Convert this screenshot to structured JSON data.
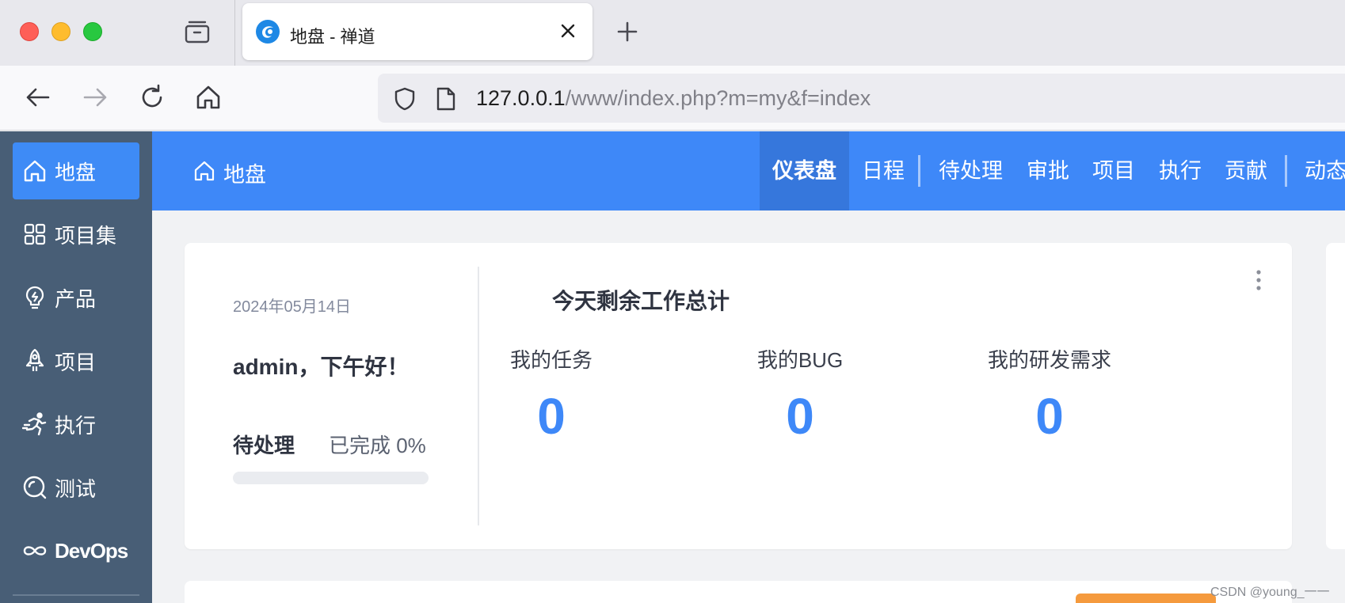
{
  "browser": {
    "tab_title": "地盘 - 禅道",
    "url_host": "127.0.0.1",
    "url_path": "/www/index.php?m=my&f=index"
  },
  "sidebar": {
    "items": [
      {
        "label": "地盘",
        "icon": "home-icon",
        "active": true
      },
      {
        "label": "项目集",
        "icon": "grid-icon",
        "active": false
      },
      {
        "label": "产品",
        "icon": "lightbulb-icon",
        "active": false
      },
      {
        "label": "项目",
        "icon": "rocket-icon",
        "active": false
      },
      {
        "label": "执行",
        "icon": "running-icon",
        "active": false
      },
      {
        "label": "测试",
        "icon": "search-circle-icon",
        "active": false
      },
      {
        "label": "DevOps",
        "icon": "infinity-icon",
        "active": false
      }
    ]
  },
  "header": {
    "title": "地盘",
    "tabs": [
      "仪表盘",
      "日程",
      "待处理",
      "审批",
      "项目",
      "执行",
      "贡献",
      "动态"
    ],
    "active_tab": "仪表盘"
  },
  "dashboard": {
    "date": "2024年05月14日",
    "greeting": "admin，下午好！",
    "pending_label": "待处理",
    "done_label": "已完成 0%",
    "progress_percent": 0,
    "heading": "今天剩余工作总计",
    "stats": [
      {
        "label": "我的任务",
        "value": "0"
      },
      {
        "label": "我的BUG",
        "value": "0"
      },
      {
        "label": "我的研发需求",
        "value": "0"
      }
    ]
  },
  "colors": {
    "accent": "#3e88f8",
    "sidebar": "#485e76",
    "active_tab": "#3677dc"
  },
  "watermark": "CSDN @young_一一"
}
